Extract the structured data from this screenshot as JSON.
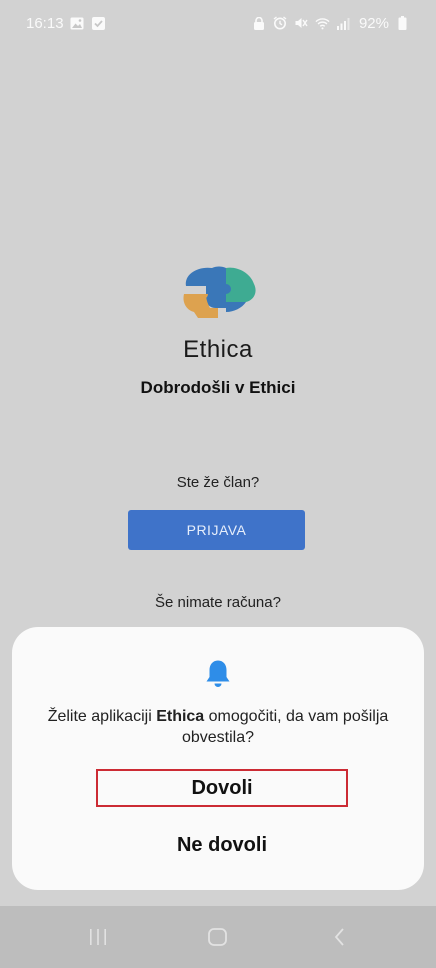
{
  "status_bar": {
    "time": "16:13",
    "battery": "92%",
    "left_icons": [
      "gallery-icon",
      "check-icon"
    ],
    "right_icons": [
      "lock-icon",
      "alarm-icon",
      "mute-icon",
      "wifi-icon",
      "signal-icon",
      "battery-icon"
    ]
  },
  "welcome": {
    "brand": "Ethica",
    "title": "Dobrodošli v Ethici",
    "member_question": "Ste že član?",
    "login_label": "PRIJAVA",
    "no_account": "Še nimate računa?"
  },
  "dialog": {
    "icon": "bell-icon",
    "message_before": "Želite aplikaciji ",
    "message_app": "Ethica",
    "message_after": " omogočiti, da vam pošilja obvestila?",
    "allow_label": "Dovoli",
    "deny_label": "Ne dovoli"
  },
  "nav": {
    "items": [
      "recent-apps",
      "home",
      "back"
    ]
  },
  "colors": {
    "background": "#d2d2d2",
    "login_button": "#3f73c9",
    "bell": "#2e8de8",
    "highlight_border": "#cc2b34",
    "dialog": "#fafafa"
  }
}
